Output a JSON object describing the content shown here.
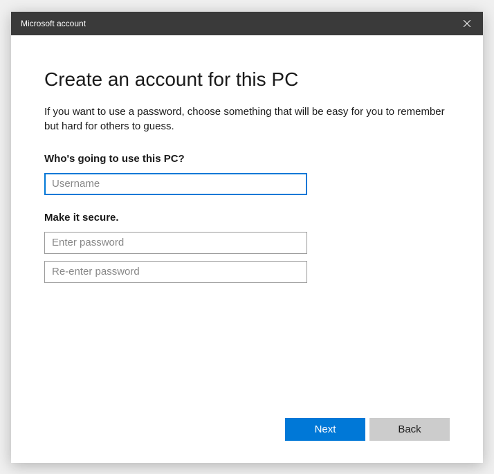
{
  "titlebar": {
    "title": "Microsoft account"
  },
  "page": {
    "heading": "Create an account for this PC",
    "description": "If you want to use a password, choose something that will be easy for you to remember but hard for others to guess."
  },
  "sections": {
    "user": {
      "label": "Who's going to use this PC?",
      "username_placeholder": "Username",
      "username_value": ""
    },
    "secure": {
      "label": "Make it secure.",
      "password_placeholder": "Enter password",
      "password_value": "",
      "reenter_placeholder": "Re-enter password",
      "reenter_value": ""
    }
  },
  "buttons": {
    "next": "Next",
    "back": "Back"
  }
}
